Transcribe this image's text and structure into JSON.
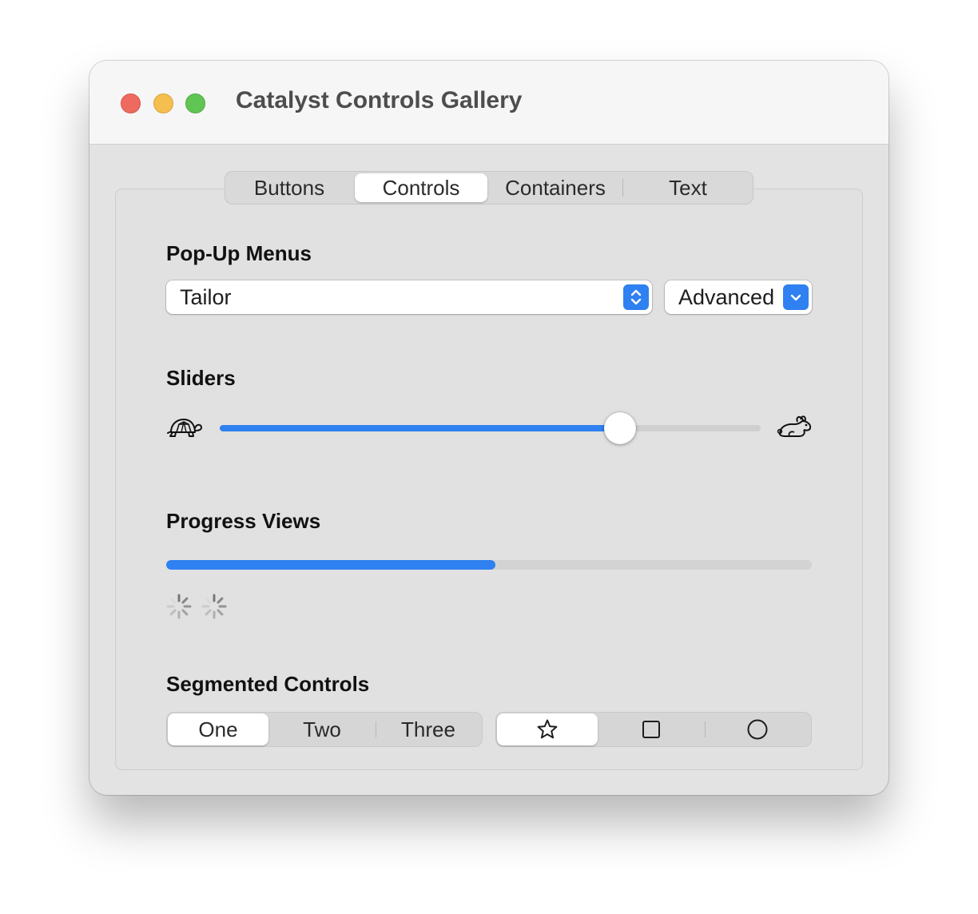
{
  "window": {
    "title": "Catalyst Controls Gallery"
  },
  "tabs": [
    {
      "label": "Buttons",
      "selected": false
    },
    {
      "label": "Controls",
      "selected": true
    },
    {
      "label": "Containers",
      "selected": false
    },
    {
      "label": "Text",
      "selected": false
    }
  ],
  "popup_menus": {
    "heading": "Pop-Up Menus",
    "main_value": "Tailor",
    "secondary_value": "Advanced"
  },
  "sliders": {
    "heading": "Sliders",
    "value": 0.74,
    "min_icon": "tortoise-icon",
    "max_icon": "hare-icon"
  },
  "progress_views": {
    "heading": "Progress Views",
    "progress": 0.51,
    "spinners": [
      "activity-spinner-icon",
      "activity-spinner-icon"
    ]
  },
  "segmented_controls": {
    "heading": "Segmented Controls",
    "text_segments": [
      {
        "label": "One",
        "selected": true
      },
      {
        "label": "Two",
        "selected": false
      },
      {
        "label": "Three",
        "selected": false
      }
    ],
    "icon_segments": [
      {
        "icon": "star-icon",
        "selected": true
      },
      {
        "icon": "square-icon",
        "selected": false
      },
      {
        "icon": "circle-icon",
        "selected": false
      }
    ]
  },
  "colors": {
    "accent": "#2f80f0",
    "close": "#ee6a5e",
    "minimize": "#f5bf4f",
    "maximize": "#61c554"
  }
}
